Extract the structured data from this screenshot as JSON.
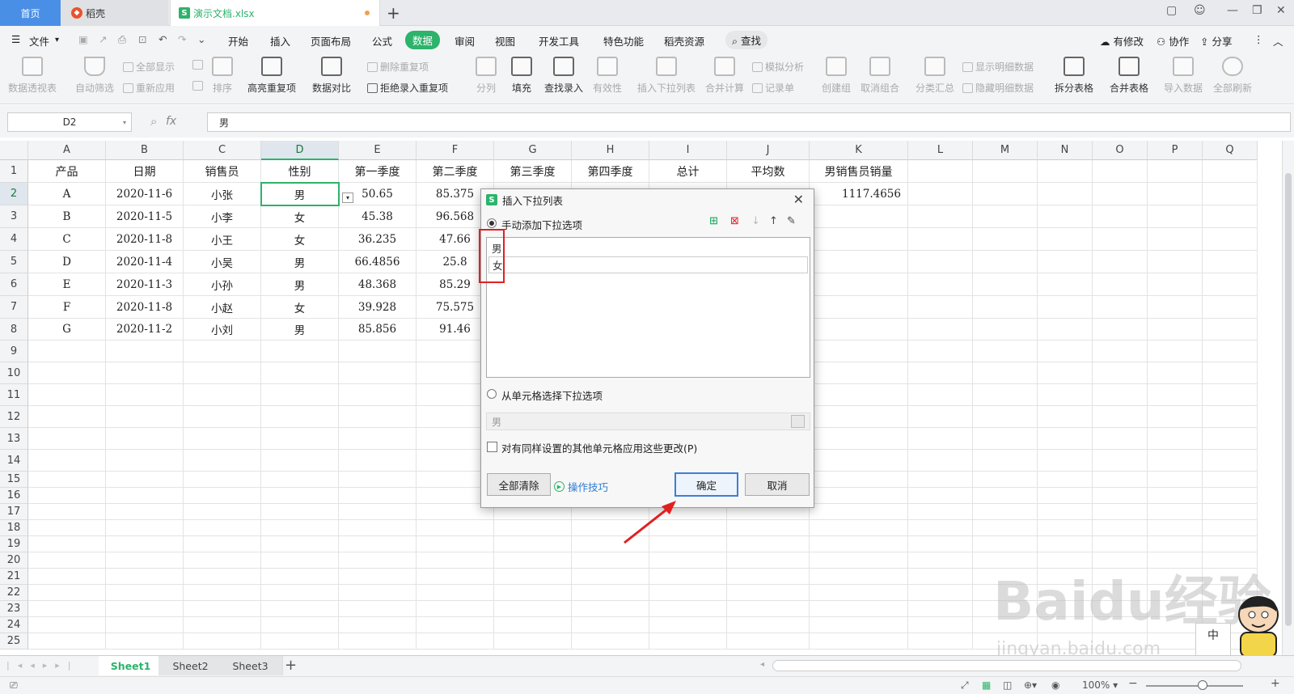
{
  "tabs": [
    {
      "label": "首页"
    },
    {
      "label": "稻壳"
    },
    {
      "label": "演示文档.xlsx"
    }
  ],
  "menu": [
    "文件",
    "开始",
    "插入",
    "页面布局",
    "公式",
    "数据",
    "审阅",
    "视图",
    "开发工具",
    "特色功能",
    "稻壳资源",
    "查找"
  ],
  "menu_active": "数据",
  "menu_right": [
    "有修改",
    "协作",
    "分享"
  ],
  "ribbon": {
    "big": [
      "数据透视表",
      "自动筛选",
      "排序",
      "高亮重复项",
      "数据对比",
      "分列",
      "填充",
      "查找录入",
      "有效性",
      "插入下拉列表",
      "合并计算",
      "创建组",
      "取消组合",
      "分类汇总",
      "拆分表格",
      "合并表格",
      "导入数据",
      "全部刷新"
    ],
    "small": [
      "全部显示",
      "重新应用",
      "删除重复项",
      "拒绝录入重复项",
      "模拟分析",
      "记录单",
      "显示明细数据",
      "隐藏明细数据"
    ]
  },
  "formula_bar": {
    "name_box": "D2",
    "fx": "fx",
    "value": "男"
  },
  "columns": [
    "A",
    "B",
    "C",
    "D",
    "E",
    "F",
    "G",
    "H",
    "I",
    "J",
    "K",
    "L",
    "M",
    "N",
    "O",
    "P",
    "Q"
  ],
  "row_numbers": [
    "1",
    "2",
    "3",
    "4",
    "5",
    "6",
    "7",
    "8",
    "9",
    "10",
    "11",
    "12",
    "13",
    "14",
    "15",
    "16",
    "17",
    "18",
    "19",
    "20",
    "21",
    "22",
    "23",
    "24",
    "25"
  ],
  "header_row": [
    "产品",
    "日期",
    "销售员",
    "性别",
    "第一季度",
    "第二季度",
    "第三季度",
    "第四季度",
    "总计",
    "平均数",
    "男销售员销量"
  ],
  "data_rows": [
    [
      "A",
      "2020-11-6",
      "小张",
      "男",
      "50.65",
      "85.375",
      "",
      "",
      "",
      "",
      "1117.4656"
    ],
    [
      "B",
      "2020-11-5",
      "小李",
      "女",
      "45.38",
      "96.568",
      "",
      "",
      "",
      "",
      ""
    ],
    [
      "C",
      "2020-11-8",
      "小王",
      "女",
      "36.235",
      "47.66",
      "",
      "",
      "",
      "",
      ""
    ],
    [
      "D",
      "2020-11-4",
      "小吴",
      "男",
      "66.4856",
      "25.8",
      "",
      "",
      "",
      "",
      ""
    ],
    [
      "E",
      "2020-11-3",
      "小孙",
      "男",
      "48.368",
      "85.29",
      "",
      "",
      "",
      "",
      ""
    ],
    [
      "F",
      "2020-11-8",
      "小赵",
      "女",
      "39.928",
      "75.575",
      "",
      "",
      "",
      "",
      ""
    ],
    [
      "G",
      "2020-11-2",
      "小刘",
      "男",
      "85.856",
      "91.46",
      "",
      "",
      "",
      "",
      ""
    ]
  ],
  "dialog": {
    "title": "插入下拉列表",
    "option_manual": "手动添加下拉选项",
    "items": [
      "男",
      "女"
    ],
    "option_cells": "从单元格选择下拉选项",
    "cell_range_value": "男",
    "apply_all": "对有同样设置的其他单元格应用这些更改(P)",
    "clear_all": "全部清除",
    "tips": "操作技巧",
    "ok": "确定",
    "cancel": "取消"
  },
  "sheets": [
    "Sheet1",
    "Sheet2",
    "Sheet3"
  ],
  "status": {
    "zoom": "100%"
  },
  "watermark": {
    "brand": "Baidu经验",
    "url": "jingyan.baidu.com"
  },
  "ime": "中",
  "colors": {
    "accent": "#2db36b",
    "tab_home": "#4a8fe6",
    "highlight": "#e02020"
  }
}
